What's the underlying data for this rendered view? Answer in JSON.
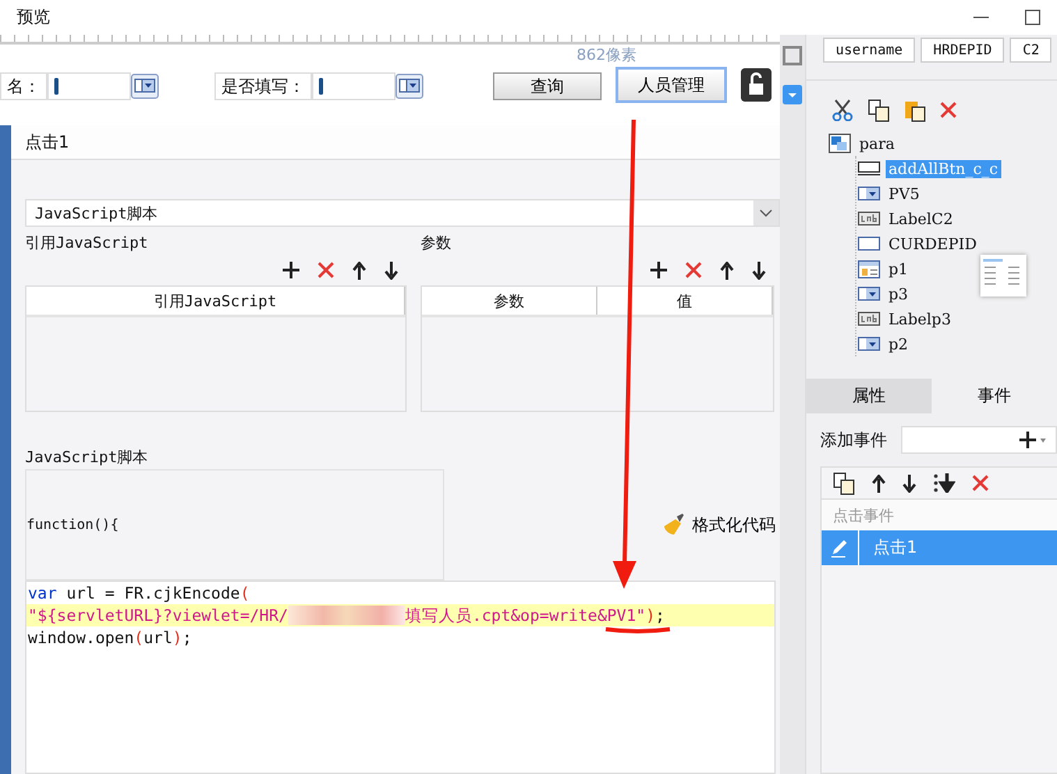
{
  "window": {
    "title": "预览"
  },
  "form": {
    "fields": [
      {
        "label": "名："
      },
      {
        "label": "是否填写："
      }
    ],
    "buttons": [
      {
        "label": "查询",
        "selected": false
      },
      {
        "label": "人员管理",
        "selected": true
      }
    ],
    "size_hint": "862像素"
  },
  "dialog": {
    "title": "点击1",
    "script_type": "JavaScript脚本",
    "sections": [
      {
        "title": "引用JavaScript",
        "columns": [
          "引用JavaScript"
        ]
      },
      {
        "title": "参数",
        "columns": [
          "参数",
          "值"
        ]
      }
    ],
    "script_title": "JavaScript脚本",
    "signature": "function(){",
    "format_button": "格式化代码",
    "lines": [
      {
        "highlighted": false,
        "tokens": [
          {
            "kind": "keyword",
            "text": "var"
          },
          {
            "kind": "plain",
            "text": " url = FR.cjkEncode"
          },
          {
            "kind": "paren",
            "text": "("
          }
        ]
      },
      {
        "highlighted": true,
        "tokens": [
          {
            "kind": "string",
            "text": "\"${servletURL}?viewlet=/HR/"
          },
          {
            "kind": "redacted"
          },
          {
            "kind": "string",
            "text": "填写人员.cpt&op=write&PV1\""
          },
          {
            "kind": "paren",
            "text": ")"
          },
          {
            "kind": "plain",
            "text": ";"
          }
        ]
      },
      {
        "highlighted": false,
        "tokens": [
          {
            "kind": "plain",
            "text": "window.open"
          },
          {
            "kind": "paren",
            "text": "("
          },
          {
            "kind": "plain",
            "text": "url"
          },
          {
            "kind": "paren",
            "text": ")"
          },
          {
            "kind": "plain",
            "text": ";"
          }
        ]
      }
    ]
  },
  "right_panel": {
    "column_tabs": [
      "username",
      "HRDEPID",
      "C2"
    ],
    "tree": {
      "label": "para",
      "children": [
        {
          "label": "addAllBtn_c_c",
          "kind": "button",
          "selected": true
        },
        {
          "label": "PV5",
          "kind": "combo",
          "selected": false
        },
        {
          "label": "LabelC2",
          "kind": "label",
          "selected": false
        },
        {
          "label": "CURDEPID",
          "kind": "text",
          "selected": false
        },
        {
          "label": "p1",
          "kind": "table",
          "selected": false
        },
        {
          "label": "p3",
          "kind": "combo",
          "selected": false
        },
        {
          "label": "Labelp3",
          "kind": "label",
          "selected": false
        },
        {
          "label": "p2",
          "kind": "combo",
          "selected": false
        }
      ]
    },
    "tabs": [
      {
        "label": "属性",
        "selected": false
      },
      {
        "label": "事件",
        "selected": true
      }
    ],
    "add_event": "添加事件",
    "events": {
      "header": "点击事件",
      "items": [
        {
          "label": "点击1",
          "selected": true
        }
      ]
    }
  }
}
